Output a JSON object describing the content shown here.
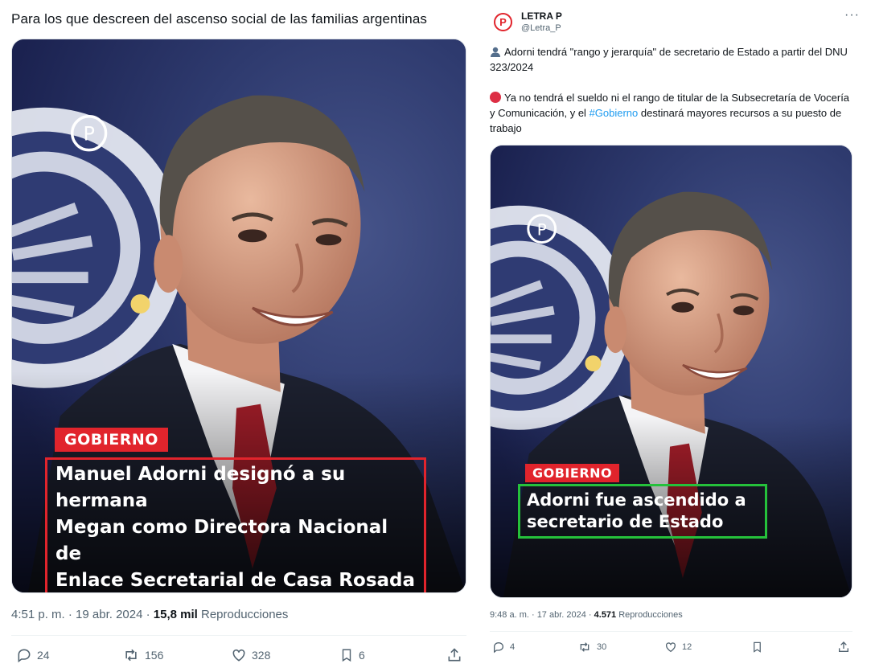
{
  "left_tweet": {
    "text": "Para los que descreen del ascenso social de las familias argentinas",
    "media": {
      "badge": "GOBIERNO",
      "headline_lines": [
        "Manuel Adorni designó a su hermana",
        "Megan como Directora Nacional de",
        "Enlace Secretarial de Casa Rosada"
      ],
      "highlight_color": "#e1242c",
      "watermark": "P"
    },
    "time": "4:51 p. m. · 19 abr. 2024 · ",
    "views_count": "15,8 mil",
    "views_label": " Reproducciones",
    "actions": {
      "replies": "24",
      "reposts": "156",
      "likes": "328",
      "bookmarks": "6"
    }
  },
  "right_tweet": {
    "author_name": "LETRA P",
    "author_handle": "@Letra_P",
    "logo_letter": "P",
    "more": "···",
    "line1": "Adorni tendrá \"rango y jerarquía\" de secretario de Estado a partir del DNU 323/2024",
    "line2_before": "Ya no tendrá el sueldo ni el rango de titular de la Subsecretaría de Vocería y Comunicación, y el ",
    "line2_hashtag": "#Gobierno",
    "line2_after": " destinará mayores recursos a su puesto de trabajo",
    "media": {
      "badge": "GOBIERNO",
      "headline_lines": [
        "Adorni fue ascendido a",
        "secretario de Estado"
      ],
      "highlight_color": "#25c13b",
      "watermark": "P"
    },
    "time": "9:48 a. m. · 17 abr. 2024 · ",
    "views_count": "4.571",
    "views_label": " Reproducciones",
    "actions": {
      "replies": "4",
      "reposts": "30",
      "likes": "12"
    }
  },
  "icons": [
    "reply-icon",
    "repost-icon",
    "like-icon",
    "bookmark-icon",
    "share-icon",
    "person-emoji-icon",
    "red-circle-emoji-icon"
  ]
}
